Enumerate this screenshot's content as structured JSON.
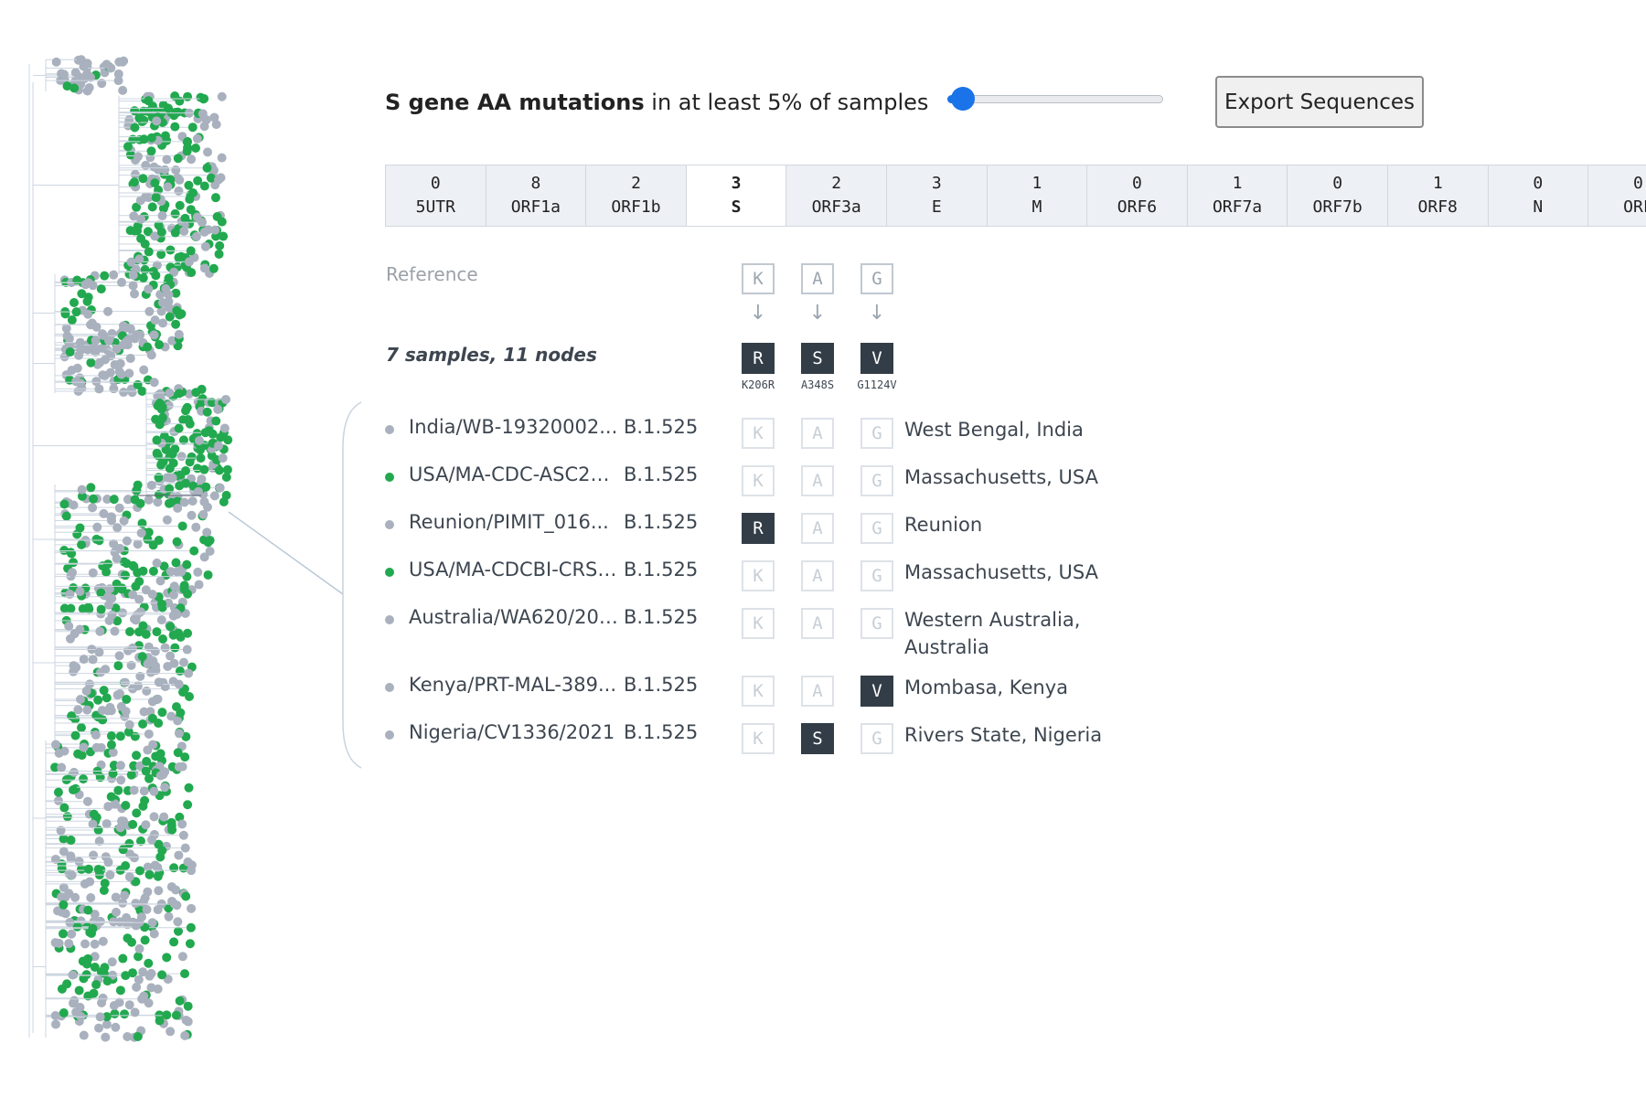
{
  "header": {
    "title_bold": "S gene AA mutations",
    "title_rest": " in at least 5% of samples",
    "threshold_percent": 5,
    "slider_fraction": 0.07,
    "export_label": "Export Sequences"
  },
  "colors": {
    "accent": "#1a73e8",
    "green_node": "#22a94f",
    "gray_node": "#a9b1be",
    "dark_box": "#333d47"
  },
  "genes": [
    {
      "count": "0",
      "name": "5UTR"
    },
    {
      "count": "8",
      "name": "ORF1a"
    },
    {
      "count": "2",
      "name": "ORF1b"
    },
    {
      "count": "3",
      "name": "S",
      "active": true
    },
    {
      "count": "2",
      "name": "ORF3a"
    },
    {
      "count": "3",
      "name": "E"
    },
    {
      "count": "1",
      "name": "M"
    },
    {
      "count": "0",
      "name": "ORF6"
    },
    {
      "count": "1",
      "name": "ORF7a"
    },
    {
      "count": "0",
      "name": "ORF7b"
    },
    {
      "count": "1",
      "name": "ORF8"
    },
    {
      "count": "0",
      "name": "N"
    },
    {
      "count": "0",
      "name": "ORF"
    }
  ],
  "reference": {
    "label": "Reference",
    "residues": [
      "K",
      "A",
      "G"
    ]
  },
  "summary": {
    "label": "7 samples, 11 nodes",
    "mutations": [
      {
        "aa": "R",
        "label": "K206R"
      },
      {
        "aa": "S",
        "label": "A348S"
      },
      {
        "aa": "V",
        "label": "G1124V"
      }
    ]
  },
  "samples": [
    {
      "name": "India/WB-19320002...",
      "lineage": "B.1.525",
      "cells": [
        "K",
        "A",
        "G"
      ],
      "mutated": [
        false,
        false,
        false
      ],
      "location": "West Bengal, India",
      "dot": "gray"
    },
    {
      "name": "USA/MA-CDC-ASC21...",
      "lineage": "B.1.525",
      "cells": [
        "K",
        "A",
        "G"
      ],
      "mutated": [
        false,
        false,
        false
      ],
      "location": "Massachusetts, USA",
      "dot": "green"
    },
    {
      "name": "Reunion/PIMIT_016...",
      "lineage": "B.1.525",
      "cells": [
        "R",
        "A",
        "G"
      ],
      "mutated": [
        true,
        false,
        false
      ],
      "location": "Reunion",
      "dot": "gray"
    },
    {
      "name": "USA/MA-CDCBI-CRSP...",
      "lineage": "B.1.525",
      "cells": [
        "K",
        "A",
        "G"
      ],
      "mutated": [
        false,
        false,
        false
      ],
      "location": "Massachusetts, USA",
      "dot": "green"
    },
    {
      "name": "Australia/WA620/2021",
      "lineage": "B.1.525",
      "cells": [
        "K",
        "A",
        "G"
      ],
      "mutated": [
        false,
        false,
        false
      ],
      "location": "Western Australia, Australia",
      "dot": "gray"
    },
    {
      "name": "Kenya/PRT-MAL-389...",
      "lineage": "B.1.525",
      "cells": [
        "K",
        "A",
        "V"
      ],
      "mutated": [
        false,
        false,
        true
      ],
      "location": "Mombasa, Kenya",
      "dot": "gray"
    },
    {
      "name": "Nigeria/CV1336/2021",
      "lineage": "B.1.525",
      "cells": [
        "K",
        "S",
        "G"
      ],
      "mutated": [
        false,
        true,
        false
      ],
      "location": "Rivers State, Nigeria",
      "dot": "gray"
    }
  ]
}
